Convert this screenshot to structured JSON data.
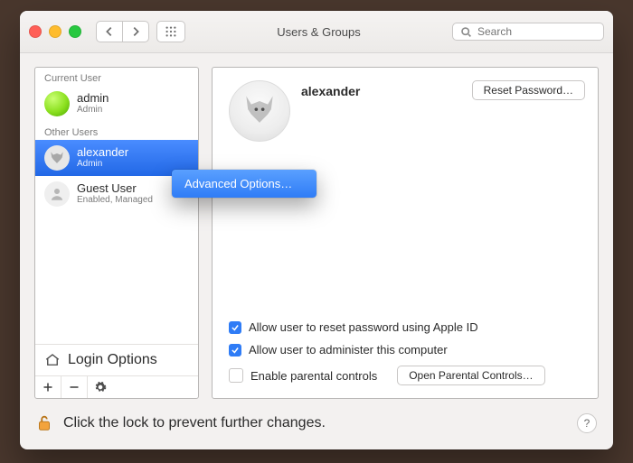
{
  "window": {
    "title": "Users & Groups"
  },
  "toolbar": {
    "search_placeholder": "Search"
  },
  "sidebar": {
    "sections": {
      "current": "Current User",
      "other": "Other Users"
    },
    "current_user": {
      "name": "admin",
      "role": "Admin"
    },
    "other_users": [
      {
        "name": "alexander",
        "role": "Admin",
        "selected": true,
        "avatar": "fox"
      },
      {
        "name": "Guest User",
        "role": "Enabled, Managed",
        "selected": false,
        "avatar": "guest"
      }
    ],
    "login_options_label": "Login Options"
  },
  "context_menu": {
    "items": [
      "Advanced Options…"
    ]
  },
  "detail": {
    "user_name": "alexander",
    "reset_password_label": "Reset Password…",
    "options": {
      "allow_reset_via_apple_id": {
        "label": "Allow user to reset password using Apple ID",
        "checked": true
      },
      "allow_admin": {
        "label": "Allow user to administer this computer",
        "checked": true
      },
      "parental_controls": {
        "label": "Enable parental controls",
        "checked": false,
        "button": "Open Parental Controls…"
      }
    }
  },
  "footer": {
    "lock_text": "Click the lock to prevent further changes."
  }
}
